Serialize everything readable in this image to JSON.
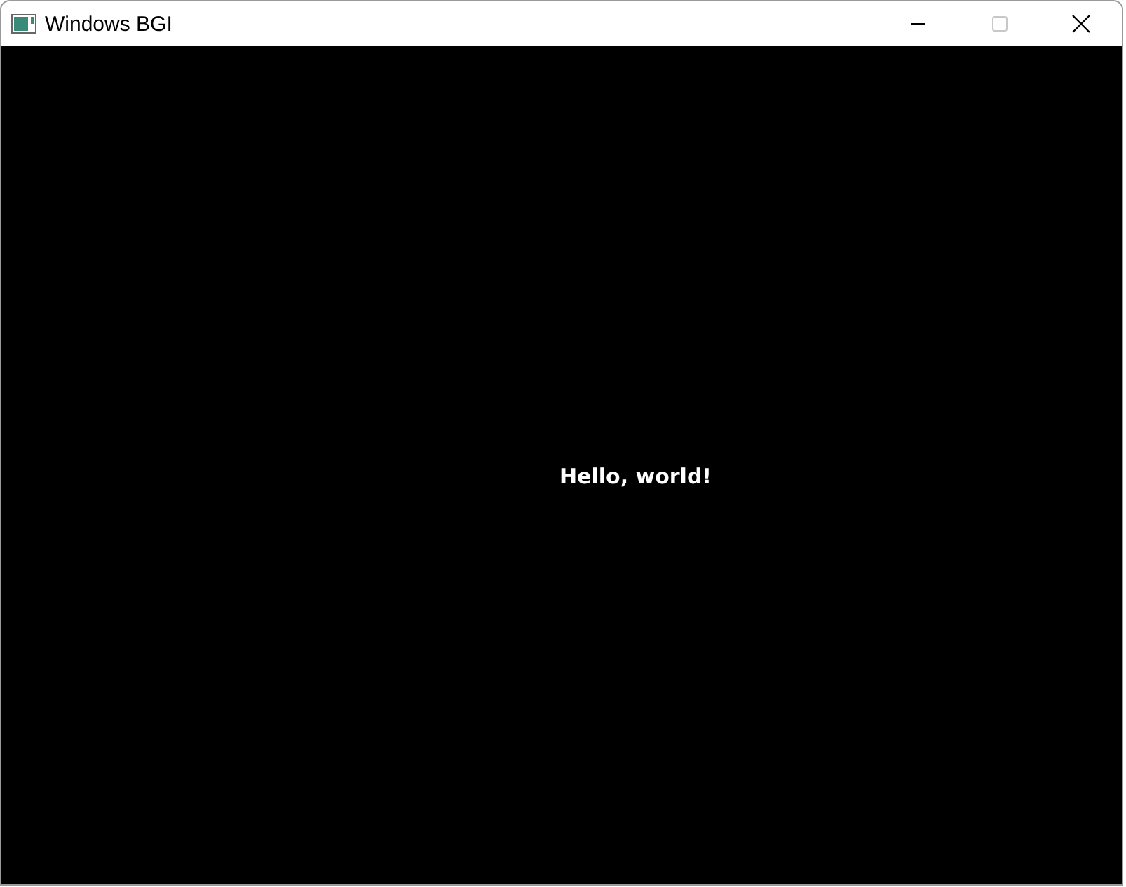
{
  "window": {
    "title": "Windows BGI",
    "maximize_disabled": true
  },
  "canvas": {
    "text": "Hello, world!"
  }
}
